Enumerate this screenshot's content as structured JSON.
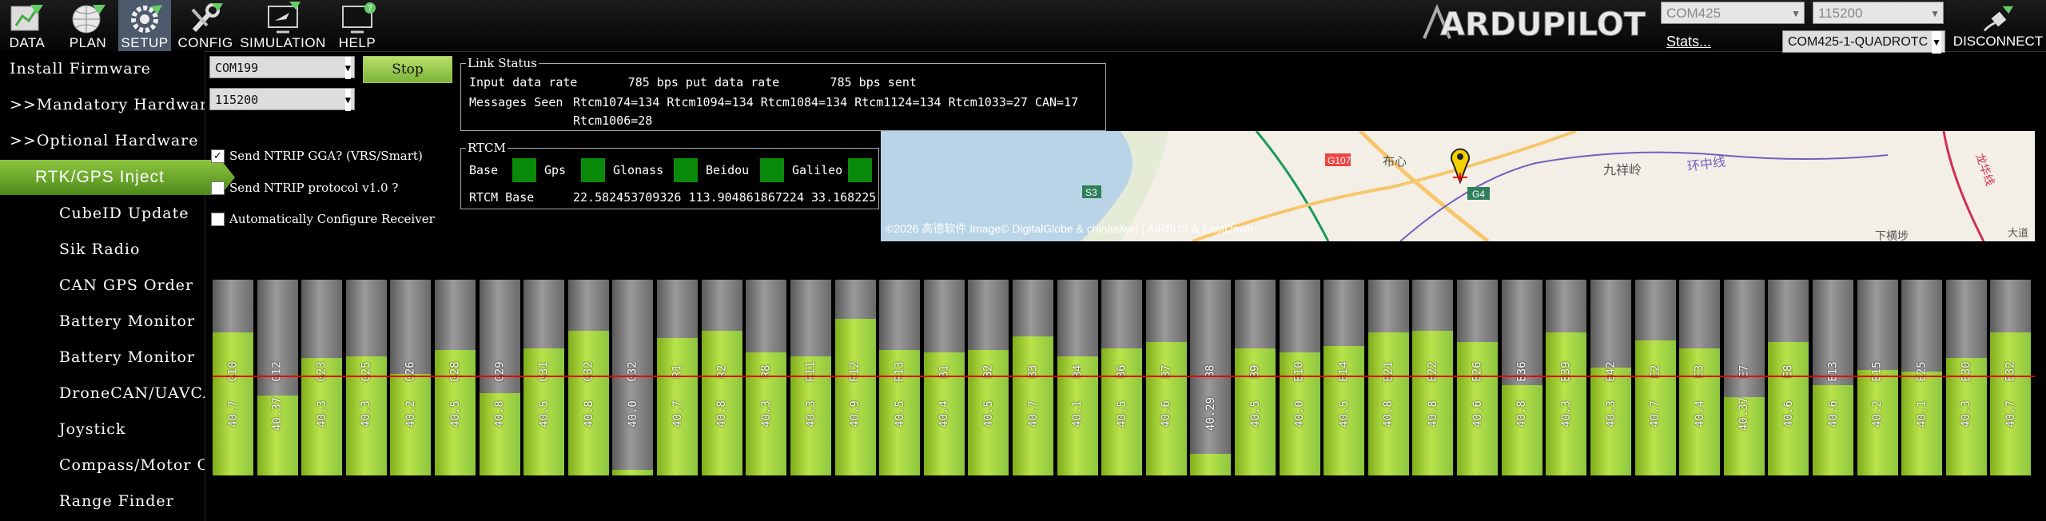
{
  "toolbar": {
    "items": [
      {
        "label": "DATA",
        "icon": "data-icon"
      },
      {
        "label": "PLAN",
        "icon": "globe-icon"
      },
      {
        "label": "SETUP",
        "icon": "gear-icon",
        "active": true
      },
      {
        "label": "CONFIG",
        "icon": "wrench-icon"
      },
      {
        "label": "SIMULATION",
        "icon": "monitor-plane-icon"
      },
      {
        "label": "HELP",
        "icon": "monitor-help-icon"
      }
    ],
    "logo_text": "ARDUPILOT",
    "port": "COM425",
    "baud": "115200",
    "stats_link": "Stats...",
    "vehicle": "COM425-1-QUADROTC",
    "disconnect_label": "DISCONNECT"
  },
  "sidebar": {
    "items": [
      {
        "label": "Install Firmware",
        "type": "top"
      },
      {
        "label": ">>Mandatory Hardware",
        "type": "top"
      },
      {
        "label": ">>Optional Hardware",
        "type": "top"
      },
      {
        "label": "RTK/GPS Inject",
        "type": "active"
      },
      {
        "label": "CubeID Update",
        "type": "sub"
      },
      {
        "label": "Sik Radio",
        "type": "sub"
      },
      {
        "label": "CAN GPS Order",
        "type": "sub"
      },
      {
        "label": "Battery Monitor",
        "type": "sub"
      },
      {
        "label": "Battery Monitor",
        "type": "sub"
      },
      {
        "label": "DroneCAN/UAVCAN",
        "type": "sub"
      },
      {
        "label": "Joystick",
        "type": "sub"
      },
      {
        "label": "Compass/Motor Ca",
        "type": "sub"
      },
      {
        "label": "Range Finder",
        "type": "sub"
      }
    ]
  },
  "inject": {
    "com_port": "COM199",
    "baud": "115200",
    "stop_label": "Stop",
    "send_gga_label": "Send NTRIP GGA? (VRS/Smart)",
    "send_gga_checked": true,
    "send_v10_label": "Send NTRIP protocol v1.0 ?",
    "send_v10_checked": false,
    "auto_config_label": "Automatically Configure Receiver",
    "auto_config_checked": false
  },
  "link_status": {
    "legend": "Link Status",
    "line1": "Input data rate       785 bps put data rate       785 bps sent",
    "msgs_label": "Messages Seen",
    "msgs_line1": "Rtcm1074=134 Rtcm1094=134 Rtcm1084=134 Rtcm1124=134 Rtcm1033=27 CAN=17",
    "msgs_line2": "Rtcm1006=28"
  },
  "rtcm": {
    "legend": "RTCM",
    "labels": [
      "Base",
      "Gps",
      "Glonass",
      "Beidou",
      "Galileo"
    ],
    "base_label": "RTCM Base",
    "base_value": "22.582453709326 113.904861867224 33.168225",
    "indicator_color": "#0a8a0a"
  },
  "map": {
    "credit": "©2026 高德软件 Image© DigitalGlobe & chinasiwei | AIRBUS & EastDawn",
    "labels": [
      "G107",
      "布心",
      "九祥岭",
      "环中线",
      "G4",
      "S3",
      "下横埗",
      "龙华线",
      "大道"
    ]
  },
  "snr": {
    "threshold": 40,
    "max": 60,
    "sats": [
      {
        "name": "G10",
        "snr": "40.7",
        "level": 0.73
      },
      {
        "name": "G12",
        "snr": "40.37",
        "level": 0.41
      },
      {
        "name": "G23",
        "snr": "40.3",
        "level": 0.6
      },
      {
        "name": "G25",
        "snr": "40.3",
        "level": 0.61
      },
      {
        "name": "G26",
        "snr": "40.2",
        "level": 0.52
      },
      {
        "name": "G28",
        "snr": "40.5",
        "level": 0.64
      },
      {
        "name": "G29",
        "snr": "40.8",
        "level": 0.42
      },
      {
        "name": "G31",
        "snr": "40.5",
        "level": 0.65
      },
      {
        "name": "G32",
        "snr": "40.8",
        "level": 0.74
      },
      {
        "name": "G32",
        "snr": "40.0",
        "level": 0.03
      },
      {
        "name": "R1",
        "snr": "40.7",
        "level": 0.7
      },
      {
        "name": "R2",
        "snr": "40.8",
        "level": 0.74
      },
      {
        "name": "R8",
        "snr": "40.3",
        "level": 0.63
      },
      {
        "name": "R11",
        "snr": "40.3",
        "level": 0.61
      },
      {
        "name": "R12",
        "snr": "40.9",
        "level": 0.8
      },
      {
        "name": "R13",
        "snr": "40.5",
        "level": 0.64
      },
      {
        "name": "B1",
        "snr": "40.4",
        "level": 0.63
      },
      {
        "name": "B2",
        "snr": "40.5",
        "level": 0.64
      },
      {
        "name": "B3",
        "snr": "40.7",
        "level": 0.71
      },
      {
        "name": "B4",
        "snr": "40.1",
        "level": 0.61
      },
      {
        "name": "B6",
        "snr": "40.5",
        "level": 0.65
      },
      {
        "name": "B7",
        "snr": "40.6",
        "level": 0.68
      },
      {
        "name": "B8",
        "snr": "40.29",
        "level": 0.11
      },
      {
        "name": "B9",
        "snr": "40.5",
        "level": 0.65
      },
      {
        "name": "B10",
        "snr": "40.0",
        "level": 0.63
      },
      {
        "name": "B14",
        "snr": "40.5",
        "level": 0.66
      },
      {
        "name": "B21",
        "snr": "40.8",
        "level": 0.73
      },
      {
        "name": "B22",
        "snr": "40.8",
        "level": 0.74
      },
      {
        "name": "B26",
        "snr": "40.6",
        "level": 0.68
      },
      {
        "name": "B36",
        "snr": "40.8",
        "level": 0.46
      },
      {
        "name": "B39",
        "snr": "40.3",
        "level": 0.73
      },
      {
        "name": "B42",
        "snr": "40.3",
        "level": 0.55
      },
      {
        "name": "E2",
        "snr": "40.7",
        "level": 0.69
      },
      {
        "name": "E3",
        "snr": "40.4",
        "level": 0.65
      },
      {
        "name": "E7",
        "snr": "40.37",
        "level": 0.4
      },
      {
        "name": "E8",
        "snr": "40.6",
        "level": 0.68
      },
      {
        "name": "E13",
        "snr": "40.6",
        "level": 0.46
      },
      {
        "name": "E15",
        "snr": "40.2",
        "level": 0.54
      },
      {
        "name": "E25",
        "snr": "40.1",
        "level": 0.53
      },
      {
        "name": "E30",
        "snr": "40.3",
        "level": 0.6
      },
      {
        "name": "E32",
        "snr": "40.7",
        "level": 0.73
      }
    ]
  }
}
